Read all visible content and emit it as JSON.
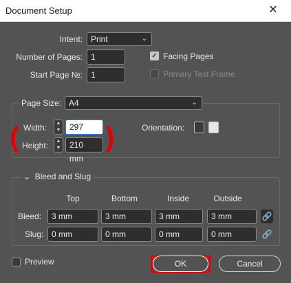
{
  "window": {
    "title": "Document Setup",
    "close_glyph": "✕"
  },
  "intent": {
    "label": "Intent:",
    "value": "Print"
  },
  "pages": {
    "label": "Number of Pages:",
    "value": "1"
  },
  "start_page": {
    "label": "Start Page №:",
    "value": "1"
  },
  "facing_pages": {
    "label": "Facing Pages",
    "checked": true
  },
  "primary_text_frame": {
    "label": "Primary Text Frame",
    "checked": false,
    "enabled": false
  },
  "page_size": {
    "label": "Page Size:",
    "value": "A4",
    "width_label": "Width:",
    "width_value": "297 mm",
    "height_label": "Height:",
    "height_value": "210 mm",
    "orientation_label": "Orientation:",
    "orientation_selected": "landscape"
  },
  "bleed_slug": {
    "title": "Bleed and Slug",
    "columns": [
      "Top",
      "Bottom",
      "Inside",
      "Outside"
    ],
    "bleed_label": "Bleed:",
    "bleed_values": [
      "3 mm",
      "3 mm",
      "3 mm",
      "3 mm"
    ],
    "slug_label": "Slug:",
    "slug_values": [
      "0 mm",
      "0 mm",
      "0 mm",
      "0 mm"
    ]
  },
  "preview": {
    "label": "Preview",
    "checked": false
  },
  "buttons": {
    "ok": "OK",
    "cancel": "Cancel"
  },
  "annotation_color": "#e40000"
}
